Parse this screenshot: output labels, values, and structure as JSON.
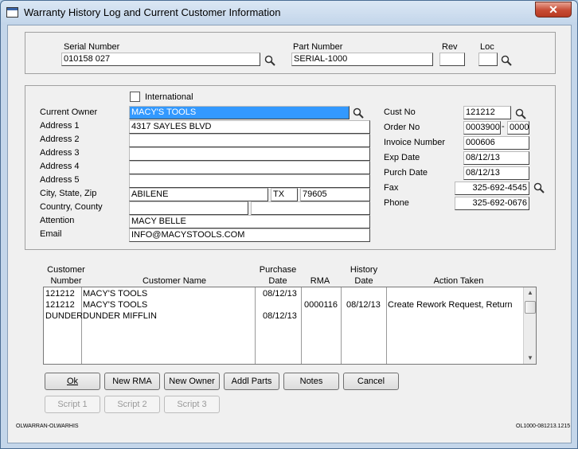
{
  "window": {
    "title": "Warranty History Log and Current Customer Information",
    "close_label": "✕"
  },
  "header": {
    "serial_label": "Serial Number",
    "serial_value": "010158   027",
    "part_label": "Part Number",
    "part_value": "SERIAL-1000",
    "rev_label": "Rev",
    "rev_value": "",
    "loc_label": "Loc",
    "loc_value": ""
  },
  "owner": {
    "international_label": "International",
    "international_checked": false,
    "current_owner_label": "Current Owner",
    "current_owner_value": "MACY'S TOOLS",
    "address1_label": "Address 1",
    "address1_value": "4317 SAYLES BLVD",
    "address2_label": "Address 2",
    "address2_value": "",
    "address3_label": "Address 3",
    "address3_value": "",
    "address4_label": "Address 4",
    "address4_value": "",
    "address5_label": "Address 5",
    "address5_value": "",
    "city_label": "City, State, Zip",
    "city_value": "ABILENE",
    "state_value": "TX",
    "zip_value": "79605",
    "country_label": "Country, County",
    "country_value": "",
    "county_value": "",
    "attention_label": "Attention",
    "attention_value": "MACY BELLE",
    "email_label": "Email",
    "email_value": "INFO@MACYSTOOLS.COM",
    "cust_no_label": "Cust No",
    "cust_no_value": "121212",
    "order_no_label": "Order No",
    "order_no_value": "0003900",
    "order_sep": "-",
    "order_suffix_value": "0000",
    "invoice_label": "Invoice Number",
    "invoice_value": "000606",
    "exp_date_label": "Exp Date",
    "exp_date_value": "08/12/13",
    "purch_date_label": "Purch Date",
    "purch_date_value": "08/12/13",
    "fax_label": "Fax",
    "fax_value": "325-692-4545",
    "phone_label": "Phone",
    "phone_value": "325-692-0676"
  },
  "history": {
    "columns": {
      "cust_no_1": "Customer",
      "cust_no_2": "Number",
      "name": "Customer Name",
      "purchase_1": "Purchase",
      "purchase_2": "Date",
      "rma": "RMA",
      "history_1": "History",
      "history_2": "Date",
      "action": "Action Taken"
    },
    "rows": [
      {
        "cust": "121212",
        "name": "MACY'S TOOLS",
        "purchase": "08/12/13",
        "rma": "",
        "history": "",
        "action": ""
      },
      {
        "cust": "121212",
        "name": "MACY'S TOOLS",
        "purchase": "",
        "rma": "0000116",
        "history": "08/12/13",
        "action": "Create Rework Request, Return"
      },
      {
        "cust": "DUNDER",
        "name": "DUNDER MIFFLIN",
        "purchase": "08/12/13",
        "rma": "",
        "history": "",
        "action": ""
      }
    ]
  },
  "buttons": {
    "ok": "Ok",
    "new_rma": "New RMA",
    "new_owner": "New Owner",
    "addl_parts": "Addl Parts",
    "notes": "Notes",
    "cancel": "Cancel",
    "script1": "Script 1",
    "script2": "Script 2",
    "script3": "Script 3"
  },
  "footer": {
    "left_code": "OLWARRAN-OLWARHIS",
    "right_code": "OL1000-081213.1215"
  },
  "colors": {
    "selection": "#3399ff",
    "close": "#c74b34",
    "frame": "#c4d6ea"
  }
}
